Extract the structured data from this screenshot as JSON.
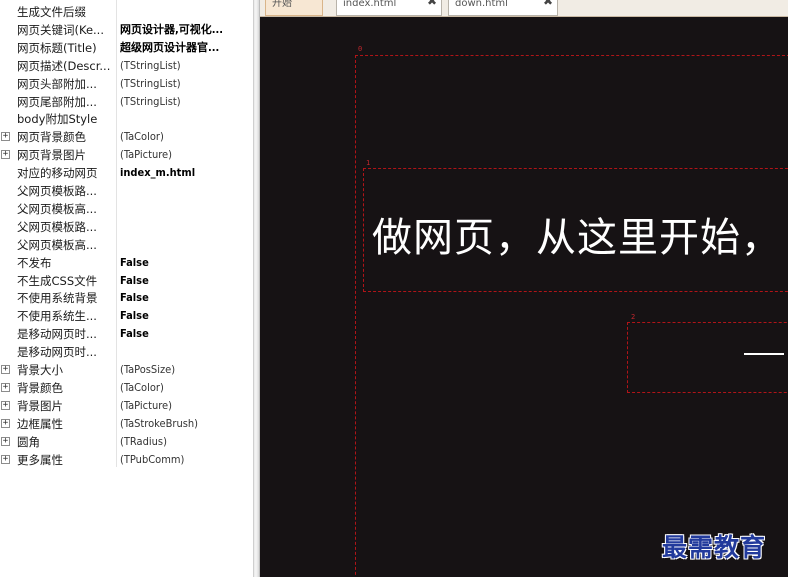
{
  "inspector": {
    "rows": [
      {
        "name": "生成文件后缀",
        "value": "",
        "style": "normal",
        "expandable": false
      },
      {
        "name": "网页关键词(Ke...",
        "value": "网页设计器,可视化...",
        "style": "bold",
        "expandable": false
      },
      {
        "name": "网页标题(Title)",
        "value": "超级网页设计器官...",
        "style": "bold",
        "expandable": false
      },
      {
        "name": "网页描述(Descr...",
        "value": "(TStringList)",
        "style": "normal",
        "expandable": false
      },
      {
        "name": "网页头部附加...",
        "value": "(TStringList)",
        "style": "normal",
        "expandable": false
      },
      {
        "name": "网页尾部附加...",
        "value": "(TStringList)",
        "style": "normal",
        "expandable": false
      },
      {
        "name": "body附加Style",
        "value": "",
        "style": "normal",
        "expandable": false
      },
      {
        "name": "网页背景颜色",
        "value": "(TaColor)",
        "style": "normal",
        "expandable": true
      },
      {
        "name": "网页背景图片",
        "value": "(TaPicture)",
        "style": "normal",
        "expandable": true
      },
      {
        "name": "对应的移动网页",
        "value": "index_m.html",
        "style": "bold",
        "expandable": false
      },
      {
        "name": "父网页模板路...",
        "value": "",
        "style": "normal",
        "expandable": false
      },
      {
        "name": "父网页模板高...",
        "value": "",
        "style": "normal",
        "expandable": false
      },
      {
        "name": "父网页模板路...",
        "value": "",
        "style": "normal",
        "expandable": false
      },
      {
        "name": "父网页模板高...",
        "value": "",
        "style": "normal",
        "expandable": false
      },
      {
        "name": "不发布",
        "value": "False",
        "style": "bold",
        "expandable": false
      },
      {
        "name": "不生成CSS文件",
        "value": "False",
        "style": "bold",
        "expandable": false
      },
      {
        "name": "不使用系统背景",
        "value": "False",
        "style": "bold",
        "expandable": false
      },
      {
        "name": "不使用系统生...",
        "value": "False",
        "style": "bold",
        "expandable": false
      },
      {
        "name": "是移动网页时...",
        "value": "False",
        "style": "bold",
        "expandable": false
      },
      {
        "name": "是移动网页时...",
        "value": "",
        "style": "normal",
        "expandable": false
      },
      {
        "name": "背景大小",
        "value": "(TaPosSize)",
        "style": "normal",
        "expandable": true
      },
      {
        "name": "背景颜色",
        "value": "(TaColor)",
        "style": "normal",
        "expandable": true
      },
      {
        "name": "背景图片",
        "value": "(TaPicture)",
        "style": "normal",
        "expandable": true
      },
      {
        "name": "边框属性",
        "value": "(TaStrokeBrush)",
        "style": "normal",
        "expandable": true
      },
      {
        "name": "圆角",
        "value": "(TRadius)",
        "style": "normal",
        "expandable": true
      },
      {
        "name": "更多属性",
        "value": "(TPubComm)",
        "style": "normal",
        "expandable": true
      }
    ],
    "expand_glyph": "+"
  },
  "editor": {
    "tabs": [
      {
        "label": "开始",
        "active": true
      },
      {
        "label": "index.html",
        "active": false
      },
      {
        "label": "down.html",
        "active": false
      }
    ],
    "close_glyph": "✖",
    "boxes": {
      "outer_tag": "0",
      "headline_tag": "1",
      "sub_tag": "2"
    },
    "headline": "做网页，从这里开始，",
    "background_color": "#161214",
    "guide_color": "#b01418"
  },
  "watermark": "最需教育"
}
